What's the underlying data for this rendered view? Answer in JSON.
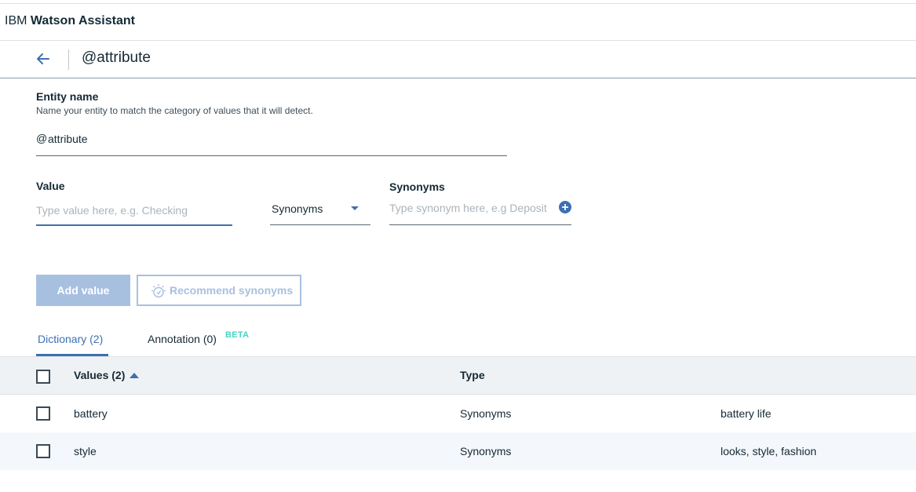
{
  "app": {
    "brand_prefix": "IBM",
    "brand_name": "Watson Assistant"
  },
  "header": {
    "title": "@attribute"
  },
  "entity": {
    "label": "Entity name",
    "help": "Name your entity to match the category of values that it will detect.",
    "prefix": "@",
    "value": "attribute"
  },
  "value_field": {
    "label": "Value",
    "placeholder": "Type value here, e.g. Checking",
    "value": ""
  },
  "type_select": {
    "selected": "Synonyms"
  },
  "synonyms_field": {
    "label": "Synonyms",
    "placeholder": "Type synonym here, e.g Deposit",
    "value": ""
  },
  "buttons": {
    "add_value": "Add value",
    "recommend": "Recommend synonyms"
  },
  "tabs": [
    {
      "label": "Dictionary (2)",
      "active": true
    },
    {
      "label": "Annotation (0)",
      "badge": "BETA",
      "active": false
    }
  ],
  "table": {
    "headers": {
      "values": "Values (2)",
      "type": "Type"
    },
    "rows": [
      {
        "value": "battery",
        "type": "Synonyms",
        "synonyms": "battery life"
      },
      {
        "value": "style",
        "type": "Synonyms",
        "synonyms": "looks, style, fashion"
      }
    ]
  },
  "colors": {
    "accent": "#3d70b2",
    "disabled": "#a8c0e0",
    "beta": "#41d6c3"
  },
  "icons": {
    "back": "arrow-left-icon",
    "add_synonym": "plus-circle-icon",
    "recommend": "watson-icon",
    "sort": "sort-ascending-icon"
  }
}
